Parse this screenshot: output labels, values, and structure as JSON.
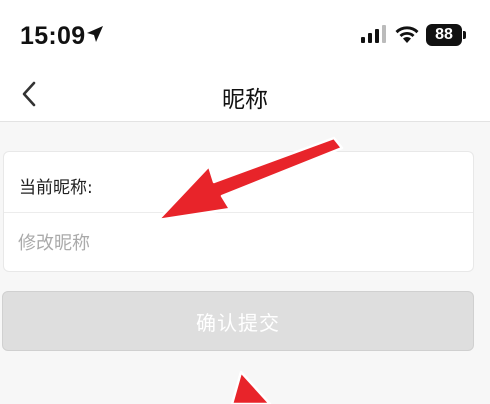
{
  "status_bar": {
    "time": "15:09",
    "battery": "88",
    "icons": [
      "location-arrow-icon",
      "cellular-signal-icon",
      "wifi-icon",
      "battery-icon"
    ]
  },
  "nav": {
    "back_icon": "chevron-left-icon",
    "title": "昵称"
  },
  "form": {
    "current_label": "当前昵称:",
    "nickname_value": "",
    "nickname_placeholder": "修改昵称"
  },
  "submit": {
    "label": "确认提交"
  },
  "colors": {
    "arrow": "#e8242a",
    "button_disabled": "#dedede"
  }
}
